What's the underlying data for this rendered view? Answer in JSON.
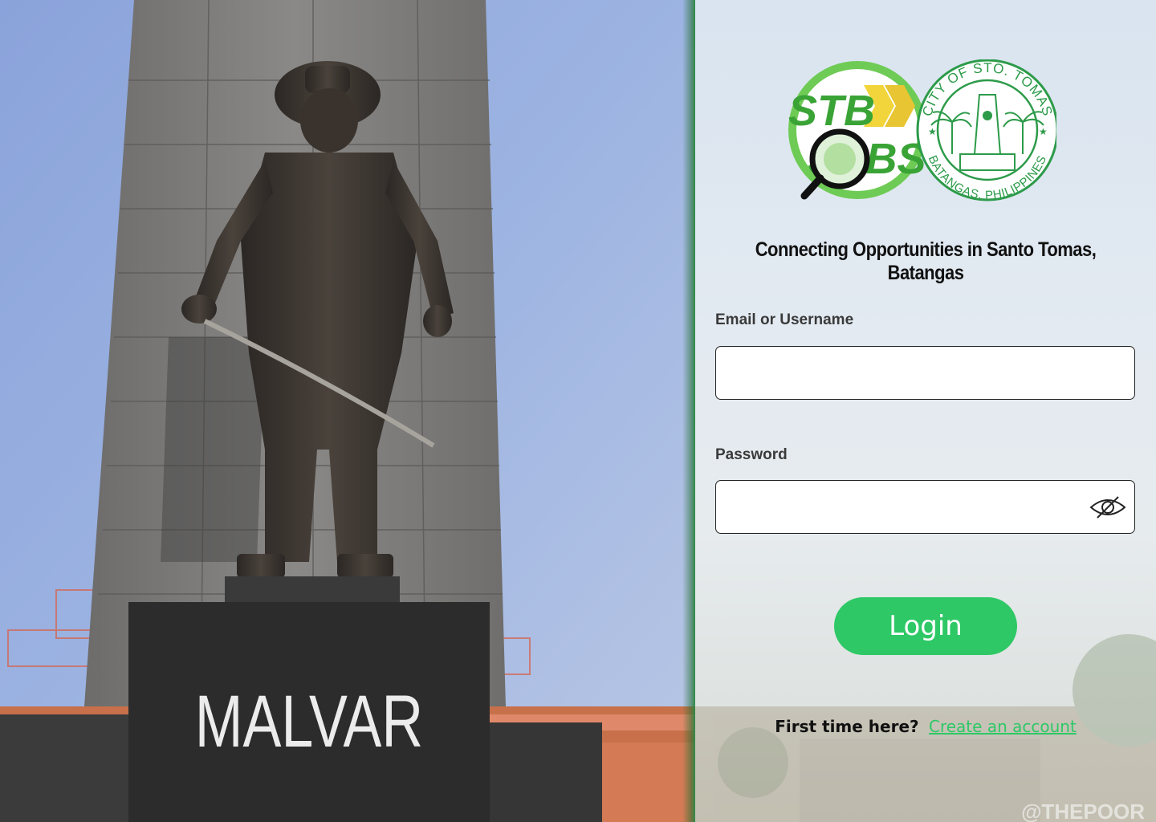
{
  "hero": {
    "monument_text": "MALVAR",
    "watermark": "@THEPOOR"
  },
  "logos": {
    "stb_top": "STB",
    "stb_bottom": "JOBS",
    "seal_top": "CITY OF STO. TOMAS",
    "seal_bottom": "BATANGAS, PHILIPPINES"
  },
  "tagline": "Connecting Opportunities in Santo Tomas, Batangas",
  "form": {
    "email_label": "Email or Username",
    "email_value": "",
    "password_label": "Password",
    "password_value": "",
    "login_label": "Login"
  },
  "signup": {
    "question": "First time here?",
    "link": "Create an account"
  },
  "colors": {
    "accent": "#2ec866",
    "panel_edge": "#2f8a45"
  },
  "icons": {
    "password_toggle": "eye-slash-icon"
  }
}
